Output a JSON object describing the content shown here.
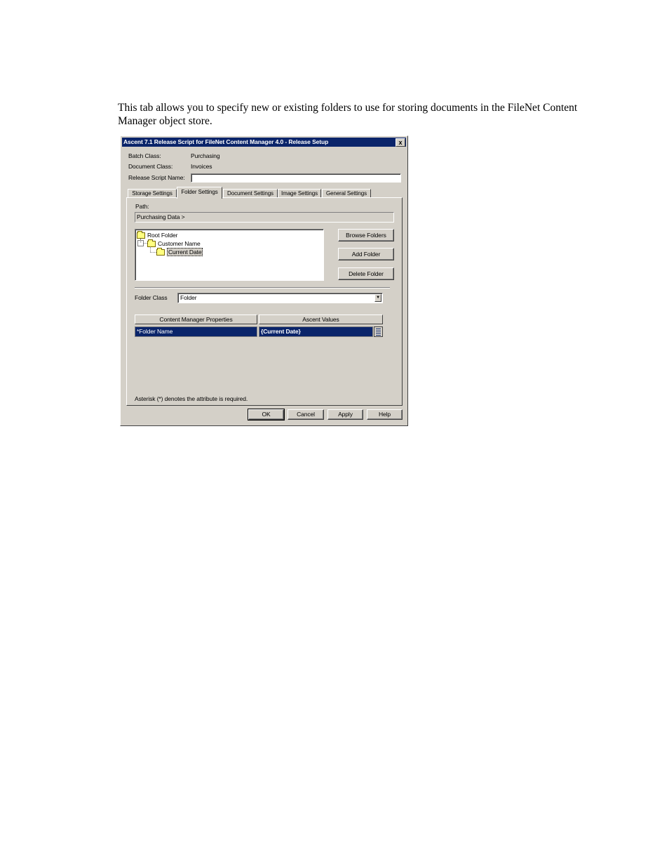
{
  "intro_text": "This tab allows you to specify new or existing folders to use for storing documents in the FileNet Content Manager object store.",
  "dialog": {
    "title": "Ascent 7.1 Release Script for FileNet Content Manager 4.0 - Release Setup",
    "close_glyph": "x",
    "batch_class_label": "Batch Class:",
    "batch_class_value": "Purchasing",
    "document_class_label": "Document Class:",
    "document_class_value": "Invoices",
    "release_script_label": "Release Script Name:",
    "release_script_value": "",
    "tabs": [
      {
        "label": "Storage Settings"
      },
      {
        "label": "Folder Settings"
      },
      {
        "label": "Document Settings"
      },
      {
        "label": "Image Settings"
      },
      {
        "label": "General Settings"
      }
    ],
    "active_tab": "Folder Settings",
    "path_label": "Path:",
    "path_value": "Purchasing Data >",
    "tree": [
      {
        "label": "Root Folder",
        "level": 0
      },
      {
        "label": "Customer Name",
        "level": 1,
        "expander": "-"
      },
      {
        "label": "Current Date",
        "level": 2,
        "selected": true
      }
    ],
    "browse_button": "Browse Folders",
    "add_button": "Add Folder",
    "delete_button": "Delete Folder",
    "folder_class_label": "Folder Class",
    "folder_class_value": "Folder",
    "grid_headers": [
      "Content Manager Properties",
      "Ascent Values"
    ],
    "grid_row": {
      "property": "*Folder Name",
      "value": "{Current Date}"
    },
    "footnote": "Asterisk (*) denotes the attribute is required.",
    "ok_button": "OK",
    "cancel_button": "Cancel",
    "apply_button": "Apply",
    "help_button": "Help"
  },
  "colors": {
    "titlebar": "#0a246a",
    "dialog_face": "#d4d0c8",
    "selection": "#0a246a"
  }
}
